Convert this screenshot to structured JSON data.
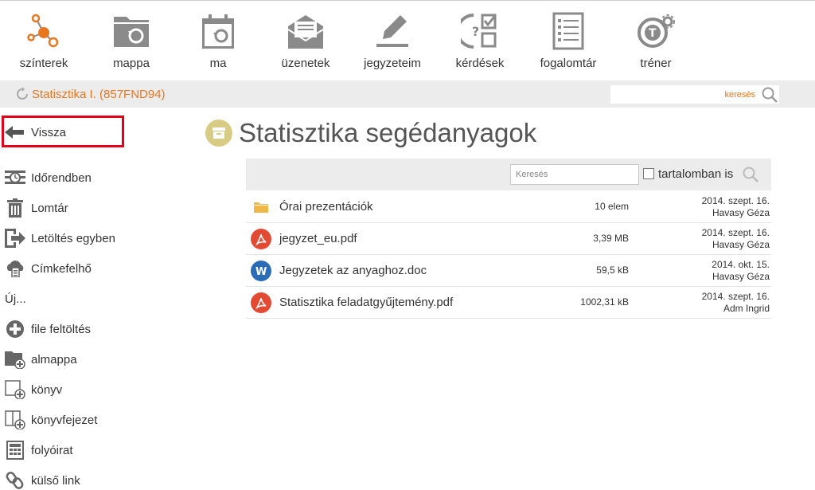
{
  "nav": {
    "items": [
      {
        "label": "színterek",
        "icon": "network-nodes-icon"
      },
      {
        "label": "mappa",
        "icon": "folder-sync-icon"
      },
      {
        "label": "ma",
        "icon": "calendar-refresh-icon"
      },
      {
        "label": "üzenetek",
        "icon": "envelope-icon"
      },
      {
        "label": "jegyzeteim",
        "icon": "pencil-note-icon"
      },
      {
        "label": "kérdések",
        "icon": "question-checklist-icon"
      },
      {
        "label": "fogalomtár",
        "icon": "glossary-list-icon"
      },
      {
        "label": "tréner",
        "icon": "trainer-gear-icon"
      }
    ],
    "accent": "#e87722"
  },
  "context": {
    "title": "Statisztika I. (857FND94)",
    "search_placeholder": "keresés"
  },
  "sidebar": {
    "back_label": "Vissza",
    "items": [
      {
        "label": "Időrendben",
        "icon": "timeline-icon"
      },
      {
        "label": "Lomtár",
        "icon": "trash-icon"
      },
      {
        "label": "Letöltés egyben",
        "icon": "download-export-icon"
      },
      {
        "label": "Címkefelhő",
        "icon": "tag-cloud-icon"
      }
    ],
    "new_label": "Új...",
    "new_items": [
      {
        "label": "file feltöltés",
        "icon": "plus-circle-icon"
      },
      {
        "label": "almappa",
        "icon": "folder-add-icon"
      },
      {
        "label": "könyv",
        "icon": "book-add-icon"
      },
      {
        "label": "könyvfejezet",
        "icon": "chapter-add-icon"
      },
      {
        "label": "folyóirat",
        "icon": "journal-icon"
      },
      {
        "label": "külső link",
        "icon": "link-icon"
      }
    ],
    "highlight_color": "#e2001a"
  },
  "main": {
    "title": "Statisztika segédanyagok",
    "filter": {
      "placeholder": "Keresés",
      "checkbox_label": "tartalomban is"
    },
    "files": [
      {
        "name": "Órai prezentációk",
        "type": "folder",
        "size": "10 elem",
        "date": "2014. szept. 16.",
        "author": "Havasy Géza"
      },
      {
        "name": "jegyzet_eu.pdf",
        "type": "pdf",
        "size": "3,39 MB",
        "date": "2014. szept. 16.",
        "author": "Havasy Géza"
      },
      {
        "name": "Jegyzetek az anyaghoz.doc",
        "type": "doc",
        "size": "59,5 kB",
        "date": "2014. okt. 15.",
        "author": "Havasy Géza"
      },
      {
        "name": "Statisztika feladatgyűjtemény.pdf",
        "type": "pdf",
        "size": "1002,31 kB",
        "date": "2014. szept. 16.",
        "author": "Adm Ingrid"
      }
    ]
  }
}
